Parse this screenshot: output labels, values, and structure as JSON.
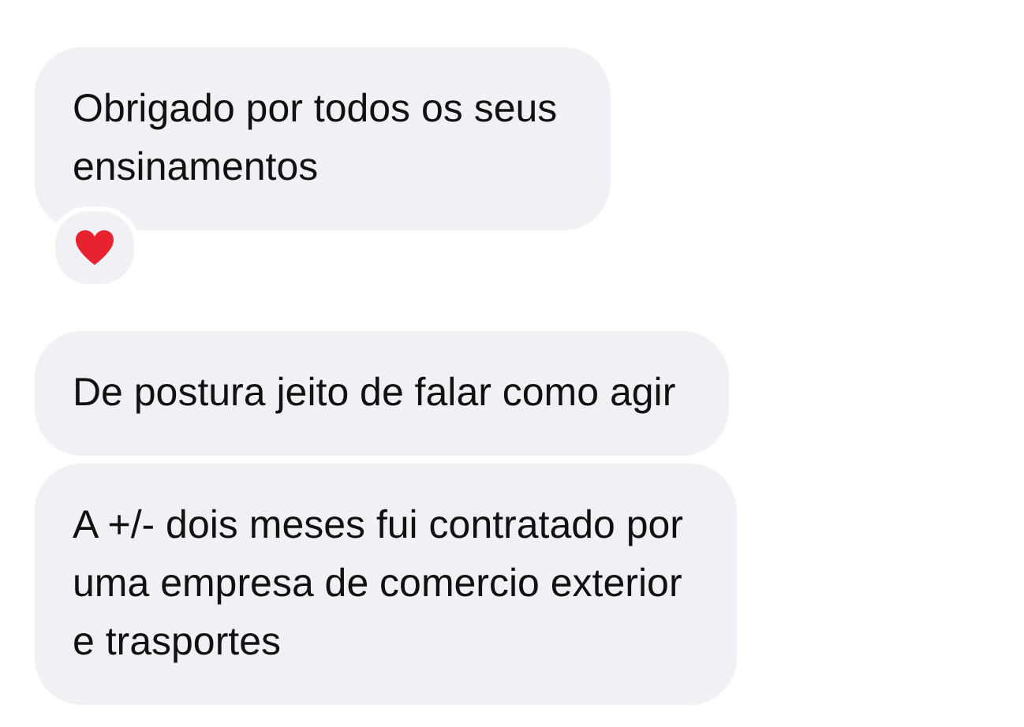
{
  "messages": [
    {
      "text": "Obrigado por todos os seus\nensinamentos",
      "reaction": {
        "kind": "heart"
      }
    },
    {
      "text": "De postura jeito de falar como agir"
    },
    {
      "text": "A +/- dois meses fui contratado por\numa empresa de comercio exterior\ne trasportes"
    }
  ]
}
